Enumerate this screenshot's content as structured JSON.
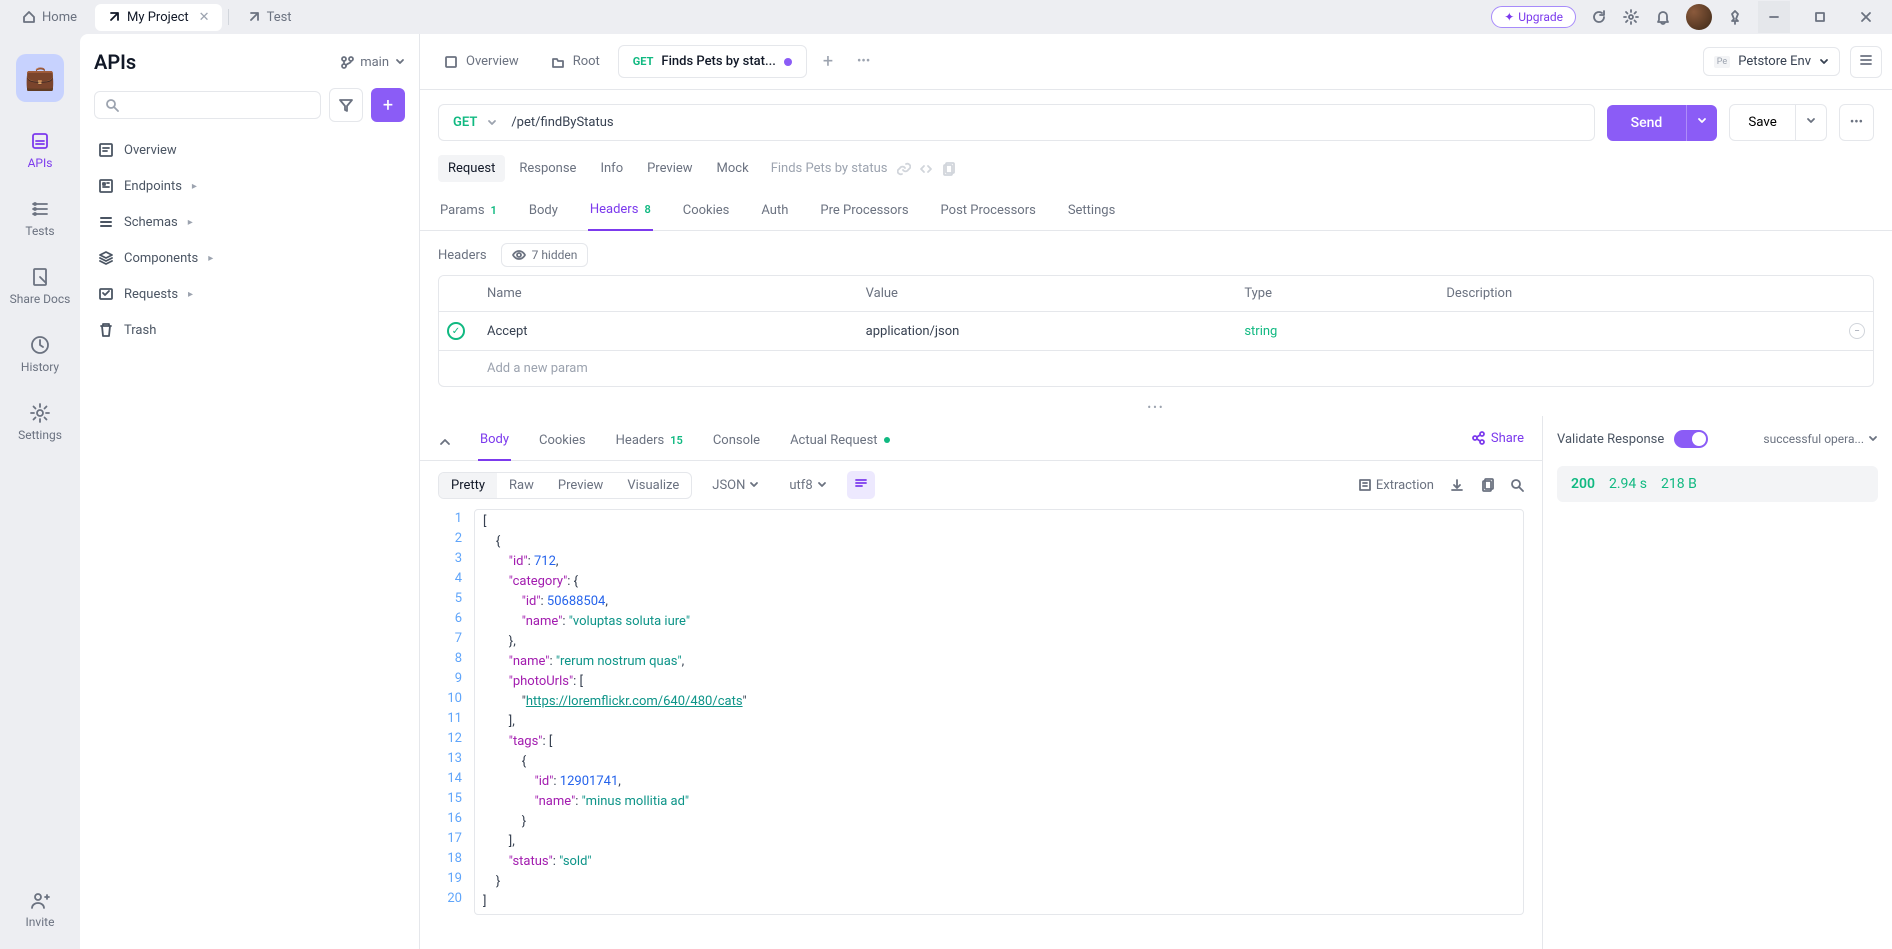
{
  "topbar": {
    "tabs": [
      {
        "icon": "home",
        "label": "Home"
      },
      {
        "icon": "external",
        "label": "My Project",
        "active": true,
        "closable": true
      },
      {
        "icon": "external",
        "label": "Test"
      }
    ],
    "upgrade": "Upgrade"
  },
  "nav": {
    "items": [
      {
        "icon": "api",
        "label": "APIs",
        "active": true
      },
      {
        "icon": "tests",
        "label": "Tests"
      },
      {
        "icon": "share",
        "label": "Share Docs"
      },
      {
        "icon": "history",
        "label": "History"
      },
      {
        "icon": "settings",
        "label": "Settings"
      },
      {
        "icon": "invite",
        "label": "Invite"
      }
    ]
  },
  "sidebar": {
    "title": "APIs",
    "branch": "main",
    "tree": [
      {
        "icon": "overview",
        "label": "Overview"
      },
      {
        "icon": "endpoints",
        "label": "Endpoints",
        "expandable": true
      },
      {
        "icon": "schemas",
        "label": "Schemas",
        "expandable": true
      },
      {
        "icon": "components",
        "label": "Components",
        "expandable": true
      },
      {
        "icon": "requests",
        "label": "Requests",
        "expandable": true
      },
      {
        "icon": "trash",
        "label": "Trash"
      }
    ]
  },
  "docTabs": [
    {
      "icon": "overview",
      "label": "Overview"
    },
    {
      "icon": "folder",
      "label": "Root"
    },
    {
      "method": "GET",
      "label": "Finds Pets by stat...",
      "active": true,
      "dirty": true
    }
  ],
  "env": {
    "badge": "Pe",
    "name": "Petstore Env"
  },
  "request": {
    "method": "GET",
    "url": "/pet/findByStatus",
    "send": "Send",
    "save": "Save"
  },
  "subTabs": {
    "items": [
      "Request",
      "Response",
      "Info",
      "Preview",
      "Mock"
    ],
    "active": "Request",
    "endpointName": "Finds Pets by status"
  },
  "paramTabs": [
    {
      "label": "Params",
      "count": "1",
      "countClass": "badge-green"
    },
    {
      "label": "Body"
    },
    {
      "label": "Headers",
      "count": "8",
      "active": true,
      "countClass": "badge-green"
    },
    {
      "label": "Cookies"
    },
    {
      "label": "Auth"
    },
    {
      "label": "Pre Processors"
    },
    {
      "label": "Post Processors"
    },
    {
      "label": "Settings"
    }
  ],
  "headersSection": {
    "label": "Headers",
    "hidden": "7 hidden",
    "cols": [
      "Name",
      "Value",
      "Type",
      "Description"
    ],
    "rows": [
      {
        "name": "Accept",
        "value": "application/json",
        "type": "string",
        "desc": ""
      }
    ],
    "addPlaceholder": "Add a new param"
  },
  "respTabs": [
    {
      "label": "Body",
      "active": true
    },
    {
      "label": "Cookies"
    },
    {
      "label": "Headers",
      "count": "15"
    },
    {
      "label": "Console"
    },
    {
      "label": "Actual Request",
      "dot": true
    }
  ],
  "share": "Share",
  "respToolbar": {
    "seg": [
      "Pretty",
      "Raw",
      "Preview",
      "Visualize"
    ],
    "segActive": "Pretty",
    "format": "JSON",
    "encoding": "utf8",
    "extraction": "Extraction"
  },
  "responseBody": {
    "lines": [
      "[",
      "    {",
      "        \"id\": 712,",
      "        \"category\": {",
      "            \"id\": 50688504,",
      "            \"name\": \"voluptas soluta iure\"",
      "        },",
      "        \"name\": \"rerum nostrum quas\",",
      "        \"photoUrls\": [",
      "            \"https://loremflickr.com/640/480/cats\"",
      "        ],",
      "        \"tags\": [",
      "            {",
      "                \"id\": 12901741,",
      "                \"name\": \"minus mollitia ad\"",
      "            }",
      "        ],",
      "        \"status\": \"sold\"",
      "    }",
      "]"
    ]
  },
  "validate": {
    "label": "Validate Response",
    "operation": "successful opera..."
  },
  "status": {
    "code": "200",
    "time": "2.94 s",
    "size": "218 B"
  }
}
